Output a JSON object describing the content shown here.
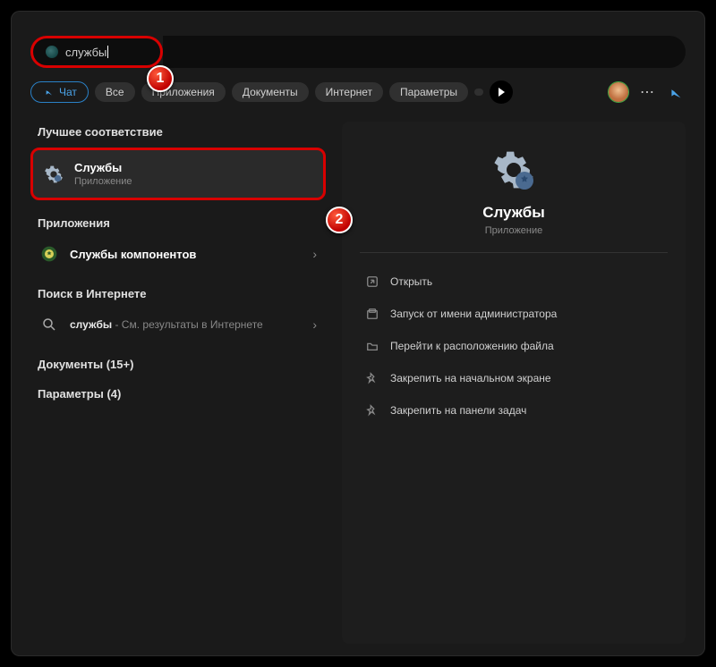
{
  "search": {
    "value": "службы"
  },
  "chips": {
    "chat": "Чат",
    "all": "Все",
    "apps": "Приложения",
    "docs": "Документы",
    "internet": "Интернет",
    "settings": "Параметры"
  },
  "left": {
    "best_match_header": "Лучшее соответствие",
    "best": {
      "title": "Службы",
      "sub": "Приложение"
    },
    "apps_header": "Приложения",
    "app_result": {
      "prefix": "Службы",
      "rest": " компонентов"
    },
    "web_header": "Поиск в Интернете",
    "web_result": {
      "query": "службы",
      "rest": " - См. результаты в Интернете"
    },
    "docs_header": "Документы (15+)",
    "params_header": "Параметры (4)"
  },
  "right": {
    "title": "Службы",
    "sub": "Приложение",
    "actions": {
      "open": "Открыть",
      "admin": "Запуск от имени администратора",
      "location": "Перейти к расположению файла",
      "pin_start": "Закрепить на начальном экране",
      "pin_task": "Закрепить на панели задач"
    }
  },
  "badges": {
    "one": "1",
    "two": "2"
  }
}
